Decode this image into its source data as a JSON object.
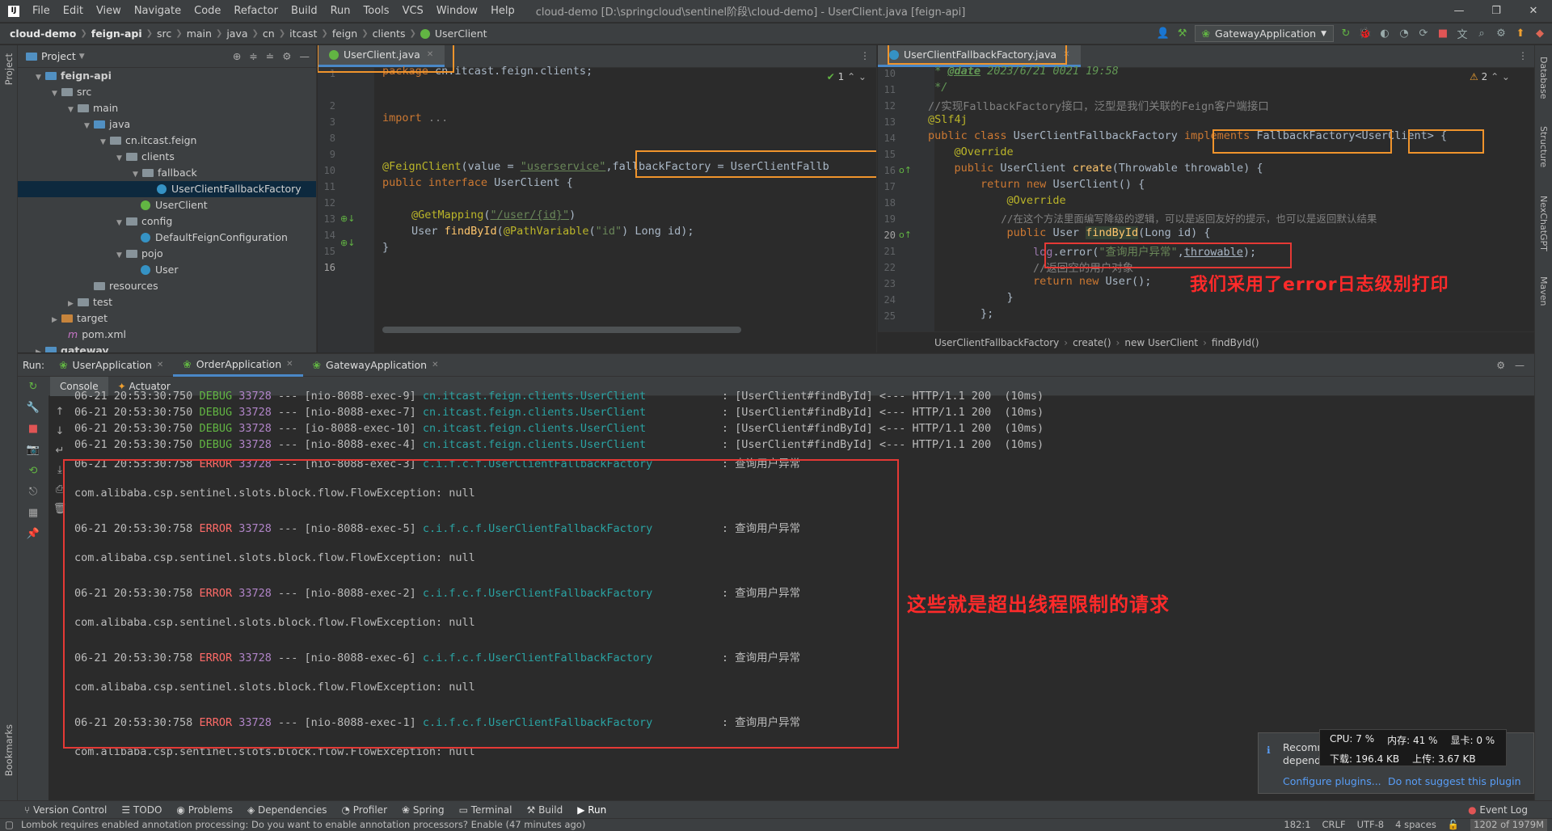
{
  "window": {
    "title": "cloud-demo [D:\\springcloud\\sentinel阶段\\cloud-demo] - UserClient.java [feign-api]",
    "menu": [
      "File",
      "Edit",
      "View",
      "Navigate",
      "Code",
      "Refactor",
      "Build",
      "Run",
      "Tools",
      "VCS",
      "Window",
      "Help"
    ],
    "controls": [
      "—",
      "❐",
      "✕"
    ]
  },
  "breadcrumb": [
    "cloud-demo",
    "feign-api",
    "src",
    "main",
    "java",
    "cn",
    "itcast",
    "feign",
    "clients",
    "UserClient"
  ],
  "run_config": "GatewayApplication",
  "left_strip": {
    "project": "Project",
    "bookmarks": "Bookmarks"
  },
  "right_strip": [
    "Database",
    "Structure",
    "NexChatGPT",
    "Maven"
  ],
  "project_panel": {
    "title": "Project",
    "tree": [
      {
        "label": "feign-api",
        "bold": true
      },
      {
        "label": "src"
      },
      {
        "label": "main"
      },
      {
        "label": "java"
      },
      {
        "label": "cn.itcast.feign"
      },
      {
        "label": "clients"
      },
      {
        "label": "fallback"
      },
      {
        "label": "UserClientFallbackFactory"
      },
      {
        "label": "UserClient"
      },
      {
        "label": "config"
      },
      {
        "label": "DefaultFeignConfiguration"
      },
      {
        "label": "pojo"
      },
      {
        "label": "User"
      },
      {
        "label": "resources"
      },
      {
        "label": "test"
      },
      {
        "label": "target"
      },
      {
        "label": "pom.xml"
      },
      {
        "label": "gateway"
      }
    ]
  },
  "editor1": {
    "tab": "UserClient.java",
    "problems": "1",
    "lines": [
      "1",
      "2",
      "3",
      "8",
      "9",
      "10",
      "11",
      "12",
      "13",
      "14",
      "15",
      "16"
    ],
    "code": {
      "l1_kw": "package",
      "l1_rest": " cn.itcast.feign.clients;",
      "l3_kw": "import",
      "l3_rest": " ...",
      "l9_ann": "@FeignClient",
      "l9_a": "(value = ",
      "l9_s": "\"userservice\"",
      "l9_b": ",fallbackFactory = UserClientFallb",
      "l10_kw": "public interface",
      "l10_rest": " UserClient {",
      "l12_ann": "@GetMapping",
      "l12_a": "(",
      "l12_s": "\"/user/{id}\"",
      "l12_b": ")",
      "l13_a": "User ",
      "l13_fn": "findById",
      "l13_b": "(",
      "l13_ann": "@PathVariable",
      "l13_c": "(",
      "l13_s": "\"id\"",
      "l13_d": ") Long id);",
      "l14": "}"
    }
  },
  "editor2": {
    "tab": "UserClientFallbackFactory.java",
    "problems": "2",
    "lines": [
      "10",
      "11",
      "12",
      "13",
      "14",
      "15",
      "16",
      "17",
      "18",
      "19",
      "20",
      "21",
      "22",
      "23",
      "24",
      "25"
    ],
    "code": {
      "l10_a": " * ",
      "l10_tag": "@date",
      "l10_b": " 2023/6/21 0021 19:58",
      "l11": " */",
      "l12": "//实现FallbackFactory接口，泛型是我们关联的Feign客户端接口",
      "l13": "@Slf4j",
      "l14_kw": "public class",
      "l14_a": " UserClientFallbackFactory ",
      "l14_kw2": "implements",
      "l14_b": " FallbackFactory<UserClient> {",
      "l15": "    @Override",
      "l16_kw": "    public",
      "l16_a": " UserClient ",
      "l16_fn": "create",
      "l16_b": "(Throwable throwable) {",
      "l17_kw": "        return new",
      "l17_a": " UserClient() {",
      "l18": "            @Override",
      "l19": "            //在这个方法里面编写降级的逻辑，可以是返回友好的提示，也可以是返回默认结果",
      "l20_kw": "            public",
      "l20_a": " User ",
      "l20_fn": "findById",
      "l20_b": "(Long id) {",
      "l21_fd": "                log",
      "l21_a": ".error(",
      "l21_s": "\"查询用户异常\"",
      "l21_b": ",",
      "l21_c": "throwable",
      "l21_d": ");",
      "l22": "                //返回空的用户对象",
      "l23_kw": "                return new",
      "l23_a": " User();",
      "l24": "            }",
      "l25": "        };"
    },
    "breadcrumb": [
      "UserClientFallbackFactory",
      "create()",
      "new UserClient",
      "findById()"
    ]
  },
  "annotations": {
    "error_note": "我们采用了error日志级别打印",
    "limit_note": "这些就是超出线程限制的请求"
  },
  "run_panel": {
    "label": "Run:",
    "tabs": [
      "UserApplication",
      "OrderApplication",
      "GatewayApplication"
    ],
    "subtabs": [
      "Console",
      "Actuator"
    ],
    "logs": [
      {
        "time": "06-21 20:53:30:750",
        "level": "DEBUG",
        "pid": "33728",
        "thread": "--- [nio-8088-exec-9]",
        "logger": "cn.itcast.feign.clients.UserClient",
        "msg": ": [UserClient#findById] <--- HTTP/1.1 200  (10ms)"
      },
      {
        "time": "06-21 20:53:30:750",
        "level": "DEBUG",
        "pid": "33728",
        "thread": "--- [nio-8088-exec-7]",
        "logger": "cn.itcast.feign.clients.UserClient",
        "msg": ": [UserClient#findById] <--- HTTP/1.1 200  (10ms)"
      },
      {
        "time": "06-21 20:53:30:750",
        "level": "DEBUG",
        "pid": "33728",
        "thread": "--- [io-8088-exec-10]",
        "logger": "cn.itcast.feign.clients.UserClient",
        "msg": ": [UserClient#findById] <--- HTTP/1.1 200  (10ms)"
      },
      {
        "time": "06-21 20:53:30:750",
        "level": "DEBUG",
        "pid": "33728",
        "thread": "--- [nio-8088-exec-4]",
        "logger": "cn.itcast.feign.clients.UserClient",
        "msg": ": [UserClient#findById] <--- HTTP/1.1 200  (10ms)"
      },
      {
        "time": "06-21 20:53:30:758",
        "level": "ERROR",
        "pid": "33728",
        "thread": "--- [nio-8088-exec-3]",
        "logger": "c.i.f.c.f.UserClientFallbackFactory",
        "msg": ": 查询用户异常"
      },
      {
        "text": "com.alibaba.csp.sentinel.slots.block.flow.FlowException: null"
      },
      {
        "time": "06-21 20:53:30:758",
        "level": "ERROR",
        "pid": "33728",
        "thread": "--- [nio-8088-exec-5]",
        "logger": "c.i.f.c.f.UserClientFallbackFactory",
        "msg": ": 查询用户异常"
      },
      {
        "text": "com.alibaba.csp.sentinel.slots.block.flow.FlowException: null"
      },
      {
        "time": "06-21 20:53:30:758",
        "level": "ERROR",
        "pid": "33728",
        "thread": "--- [nio-8088-exec-2]",
        "logger": "c.i.f.c.f.UserClientFallbackFactory",
        "msg": ": 查询用户异常"
      },
      {
        "text": "com.alibaba.csp.sentinel.slots.block.flow.FlowException: null"
      },
      {
        "time": "06-21 20:53:30:758",
        "level": "ERROR",
        "pid": "33728",
        "thread": "--- [nio-8088-exec-6]",
        "logger": "c.i.f.c.f.UserClientFallbackFactory",
        "msg": ": 查询用户异常"
      },
      {
        "text": "com.alibaba.csp.sentinel.slots.block.flow.FlowException: null"
      },
      {
        "time": "06-21 20:53:30:758",
        "level": "ERROR",
        "pid": "33728",
        "thread": "--- [nio-8088-exec-1]",
        "logger": "c.i.f.c.f.UserClientFallbackFactory",
        "msg": ": 查询用户异常"
      },
      {
        "text": "com.alibaba.csp.sentinel.slots.block.flow.FlowException: null"
      }
    ]
  },
  "popup": {
    "text1": "Recomm",
    "text2": "depend",
    "configure": "Configure plugins...",
    "dismiss": "Do not suggest this plugin"
  },
  "perf": {
    "cpu": "CPU: 7 %",
    "mem": "内存: 41 %",
    "gpu": "显卡: 0 %",
    "down": "下载: 196.4 KB",
    "up": "上传: 3.67 KB"
  },
  "tool_windows": [
    "Version Control",
    "TODO",
    "Problems",
    "Dependencies",
    "Profiler",
    "Spring",
    "Terminal",
    "Build",
    "Run"
  ],
  "event_log": "Event Log",
  "status": {
    "message": "Lombok requires enabled annotation processing: Do you want to enable annotation processors? Enable (47 minutes ago)",
    "position": "182:1",
    "line_sep": "CRLF",
    "encoding": "UTF-8",
    "indent": "4 spaces",
    "memory": "1202 of 1979M"
  },
  "colors": {
    "accent": "#4a88c7",
    "highlight_orange": "#f0942c",
    "highlight_red": "#e53935",
    "annotation_red": "#ff2a2a"
  }
}
